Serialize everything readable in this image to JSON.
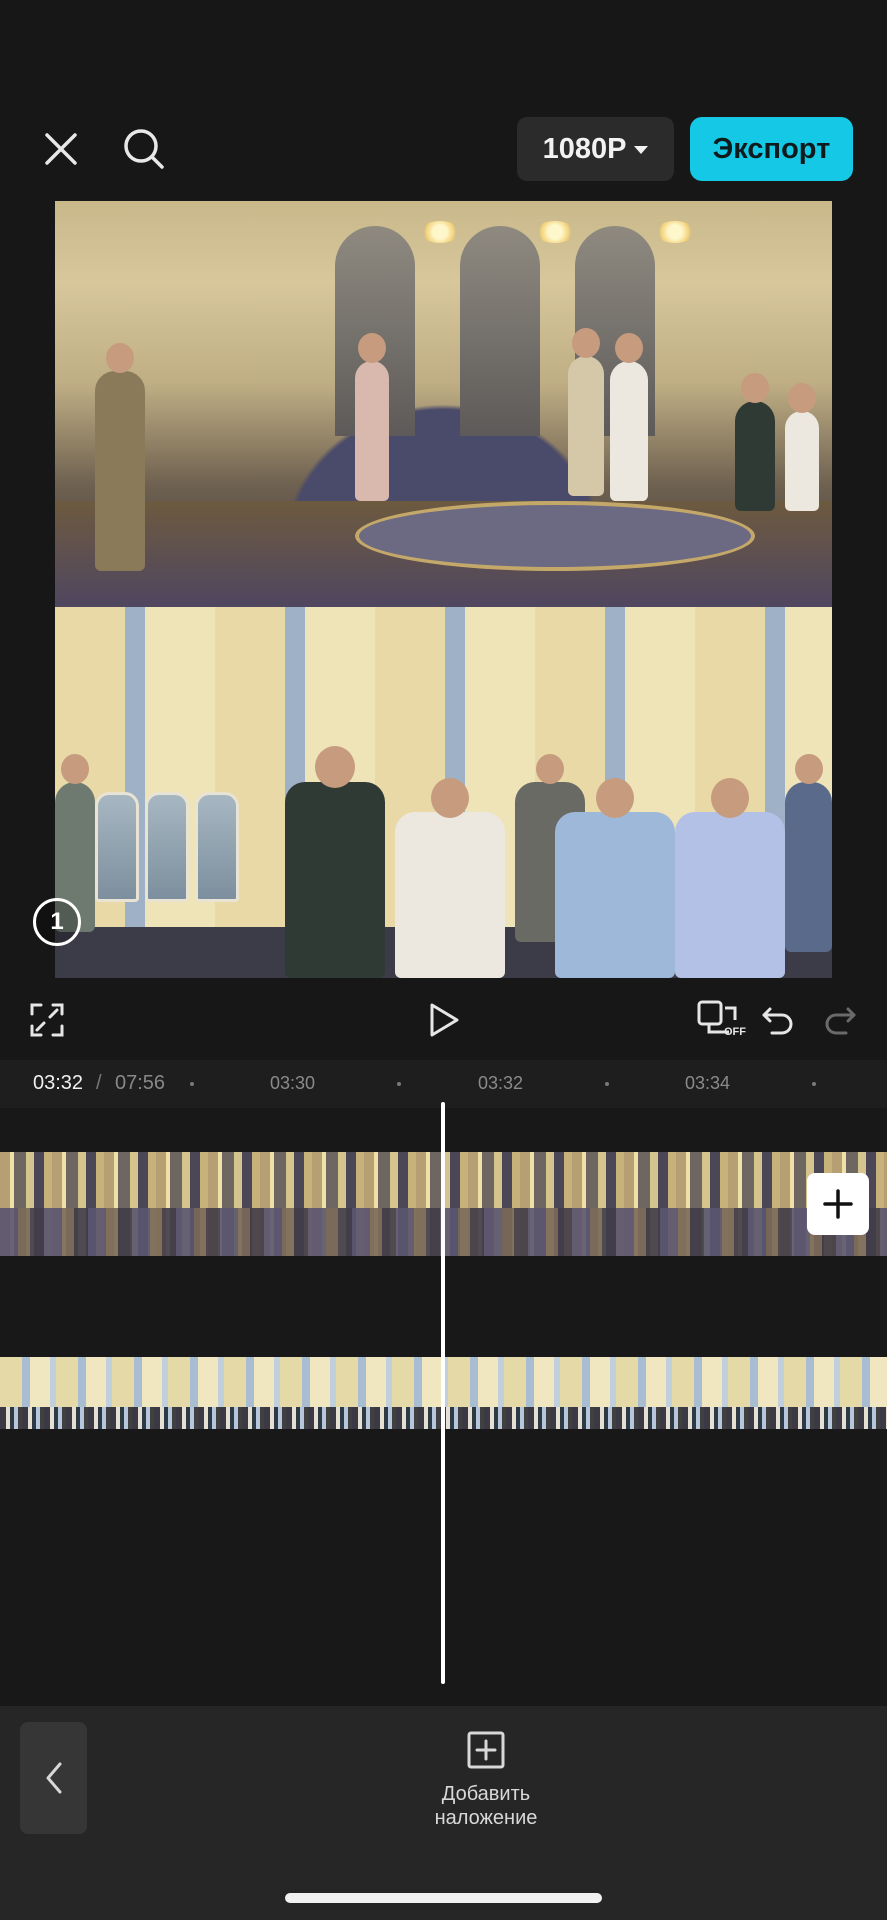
{
  "toolbar": {
    "resolution": "1080P",
    "export_label": "Экспорт"
  },
  "preview": {
    "layer_badge": "1"
  },
  "timeline": {
    "current_time": "03:32",
    "separator": "/",
    "total_time": "07:56",
    "ticks": [
      "03:30",
      "03:32",
      "03:34"
    ]
  },
  "controls": {
    "auto_caption_state": "OFF"
  },
  "bottom": {
    "overlay_label_line1": "Добавить",
    "overlay_label_line2": "наложение"
  },
  "colors": {
    "accent": "#14c8e6",
    "background": "#171717",
    "playhead": "#ffffff"
  },
  "icons": [
    "close-icon",
    "search-icon",
    "fullscreen-icon",
    "play-icon",
    "keyframe-off-icon",
    "undo-icon",
    "redo-icon",
    "add-icon",
    "chevron-left-icon",
    "add-overlay-icon"
  ]
}
